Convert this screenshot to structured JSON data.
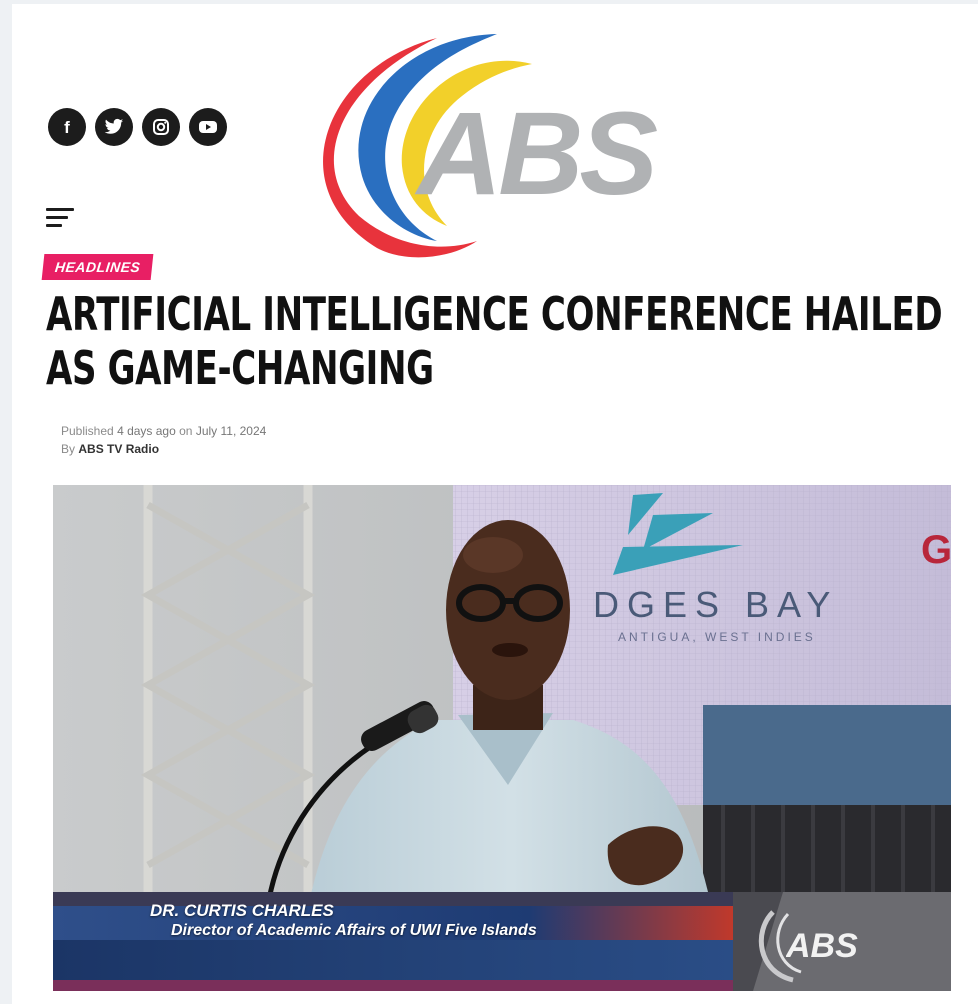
{
  "brand": {
    "logo_text": "ABS",
    "colors": {
      "red": "#e8333c",
      "blue": "#2a6fc0",
      "yellow": "#f2d02a",
      "gray": "#b0b2b4"
    }
  },
  "social": [
    {
      "icon": "facebook-icon",
      "glyph": "f"
    },
    {
      "icon": "twitter-icon",
      "glyph": "twitter"
    },
    {
      "icon": "instagram-icon",
      "glyph": "instagram"
    },
    {
      "icon": "youtube-icon",
      "glyph": "youtube"
    }
  ],
  "menu": {
    "icon": "hamburger-menu-icon"
  },
  "article": {
    "category": "HEADLINES",
    "title_line1": "ARTIFICIAL INTELLIGENCE CONFERENCE HAILED",
    "title_line2": "AS GAME-CHANGING",
    "published_prefix": "Published",
    "published_ago": "4 days ago",
    "published_on": "on",
    "published_date": "July 11, 2024",
    "by_prefix": "By",
    "author": "ABS TV Radio",
    "category_color": "#e81f64"
  },
  "hero": {
    "backdrop_text": "DGES BAY",
    "backdrop_subtext": "ANTIGUA, WEST INDIES",
    "corner_letter": "G",
    "lower_third": {
      "name": "DR. CURTIS CHARLES",
      "title": "Director of Academic Affairs of UWI Five Islands",
      "bug": "ABS"
    }
  }
}
